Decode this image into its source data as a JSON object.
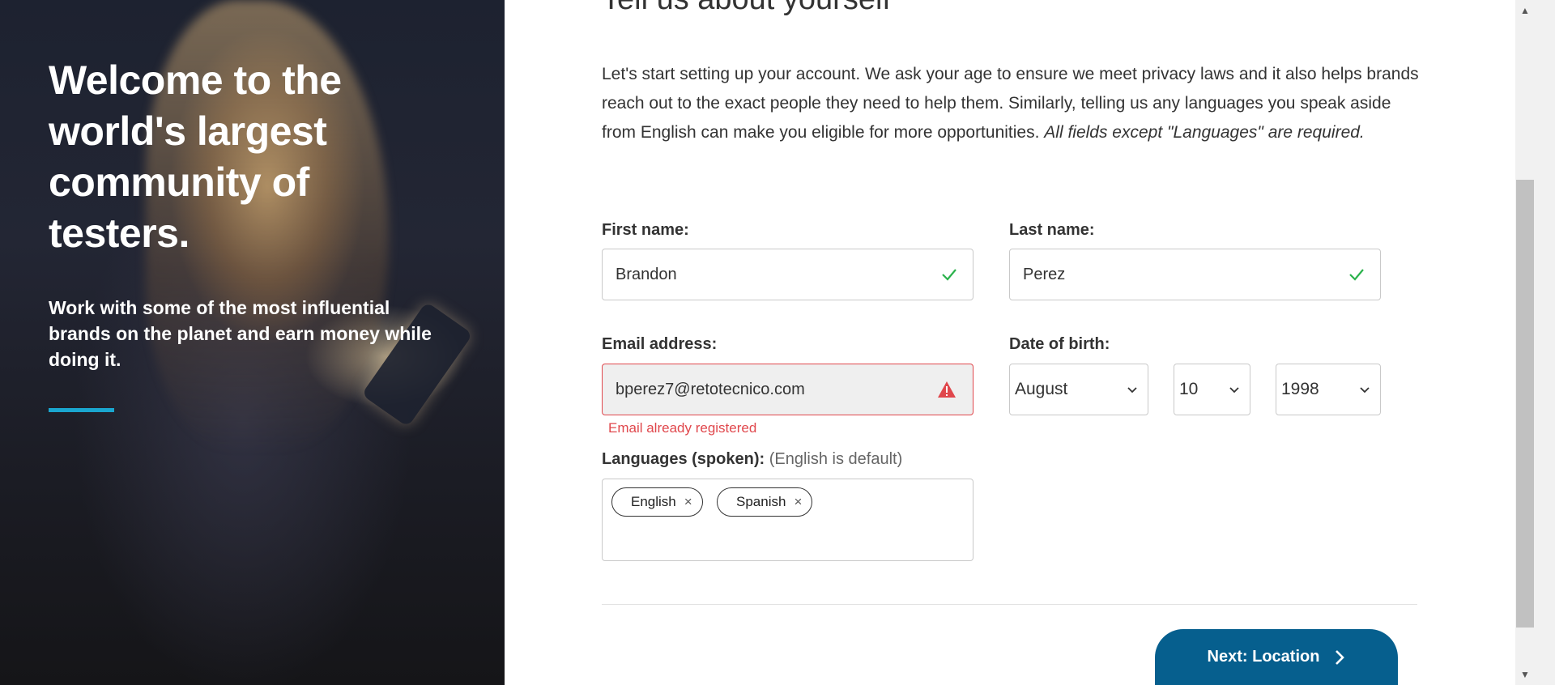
{
  "hero": {
    "title": "Welcome to the world's largest community of testers.",
    "subtitle": "Work with some of the most influential brands on the planet and earn money while doing it.",
    "accent_color": "#1aa6cf"
  },
  "form": {
    "heading": "Tell us about yourself",
    "intro": "Let's start setting up your account. We ask your age to ensure we meet privacy laws and it also helps brands reach out to the exact people they need to help them. Similarly, telling us any languages you speak aside from English can make you eligible for more opportunities. ",
    "intro_italic": "All fields except \"Languages\" are required.",
    "first_name": {
      "label": "First name:",
      "value": "Brandon",
      "status": "valid"
    },
    "last_name": {
      "label": "Last name:",
      "value": "Perez",
      "status": "valid"
    },
    "email": {
      "label": "Email address:",
      "value": "bperez7@retotecnico.com",
      "status": "error",
      "error": "Email already registered"
    },
    "dob": {
      "label": "Date of birth:",
      "month": "August",
      "day": "10",
      "year": "1998"
    },
    "languages": {
      "label": "Languages (spoken):",
      "hint": "(English is default)",
      "tags": [
        "English",
        "Spanish"
      ]
    },
    "next_button": "Next: Location",
    "colors": {
      "valid": "#2bb24c",
      "error": "#e0474c",
      "primary": "#065f8e"
    }
  },
  "scrollbar": {
    "up": "▲",
    "down": "▼"
  }
}
